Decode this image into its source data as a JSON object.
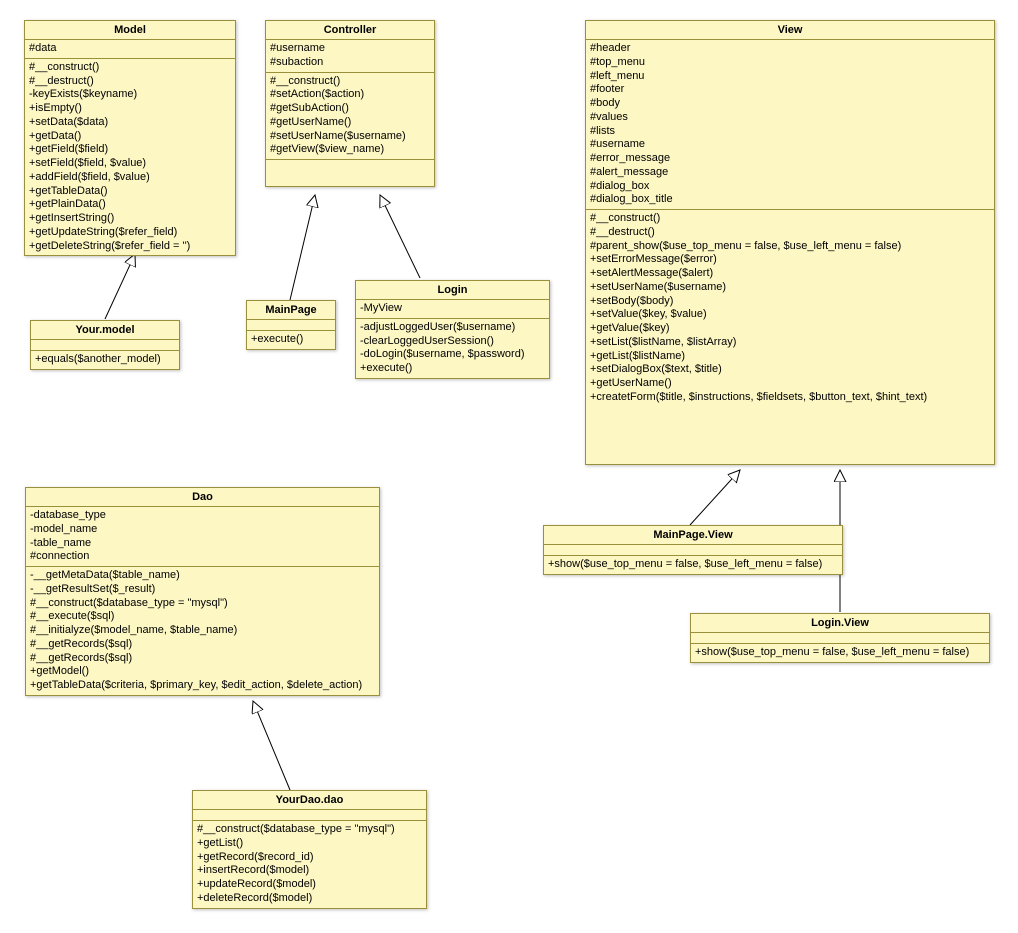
{
  "classes": {
    "model": {
      "name": "Model",
      "attributes": [
        "#data"
      ],
      "methods": [
        "#__construct()",
        "#__destruct()",
        "-keyExists($keyname)",
        "+isEmpty()",
        "+setData($data)",
        "+getData()",
        "+getField($field)",
        "+setField($field, $value)",
        "+addField($field, $value)",
        "+getTableData()",
        "+getPlainData()",
        "+getInsertString()",
        "+getUpdateString($refer_field)",
        "+getDeleteString($refer_field = '')"
      ]
    },
    "controller": {
      "name": "Controller",
      "attributes": [
        "#username",
        "#subaction"
      ],
      "methods": [
        "#__construct()",
        "#setAction($action)",
        "#getSubAction()",
        "#getUserName()",
        "#setUserName($username)",
        "#getView($view_name)"
      ]
    },
    "view": {
      "name": "View",
      "attributes": [
        "#header",
        "#top_menu",
        "#left_menu",
        "#footer",
        "#body",
        "#values",
        "#lists",
        "#username",
        "#error_message",
        "#alert_message",
        "#dialog_box",
        "#dialog_box_title"
      ],
      "methods": [
        "#__construct()",
        "#__destruct()",
        "#parent_show($use_top_menu = false, $use_left_menu = false)",
        "+setErrorMessage($error)",
        "+setAlertMessage($alert)",
        "+setUserName($username)",
        "+setBody($body)",
        "+setValue($key, $value)",
        "+getValue($key)",
        "+setList($listName, $listArray)",
        "+getList($listName)",
        "+setDialogBox($text, $title)",
        "+getUserName()",
        "+createtForm($title, $instructions, $fieldsets, $button_text, $hint_text)"
      ]
    },
    "your_model": {
      "name": "Your.model",
      "attributes": [],
      "methods": [
        "+equals($another_model)"
      ]
    },
    "mainpage": {
      "name": "MainPage",
      "attributes": [],
      "methods": [
        "+execute()"
      ]
    },
    "login": {
      "name": "Login",
      "attributes": [
        "-MyView"
      ],
      "methods": [
        "-adjustLoggedUser($username)",
        "-clearLoggedUserSession()",
        "-doLogin($username, $password)",
        "+execute()"
      ]
    },
    "dao": {
      "name": "Dao",
      "attributes": [
        "-database_type",
        "-model_name",
        "-table_name",
        "#connection"
      ],
      "methods": [
        "-__getMetaData($table_name)",
        "-__getResultSet($_result)",
        "#__construct($database_type = \"mysql\")",
        "#__execute($sql)",
        "#__initialyze($model_name, $table_name)",
        "#__getRecords($sql)",
        "#__getRecords($sql)",
        "+getModel()",
        "+getTableData($criteria, $primary_key, $edit_action, $delete_action)"
      ]
    },
    "yourdao": {
      "name": "YourDao.dao",
      "attributes": [],
      "methods": [
        "#__construct($database_type = \"mysql\")",
        "+getList()",
        "+getRecord($record_id)",
        "+insertRecord($model)",
        "+updateRecord($model)",
        "+deleteRecord($model)"
      ]
    },
    "mainpage_view": {
      "name": "MainPage.View",
      "attributes": [],
      "methods": [
        "+show($use_top_menu = false, $use_left_menu = false)"
      ]
    },
    "login_view": {
      "name": "Login.View",
      "attributes": [],
      "methods": [
        "+show($use_top_menu = false, $use_left_menu = false)"
      ]
    }
  },
  "relationships": [
    {
      "from": "your_model",
      "to": "model",
      "type": "generalization"
    },
    {
      "from": "mainpage",
      "to": "controller",
      "type": "generalization"
    },
    {
      "from": "login",
      "to": "controller",
      "type": "generalization"
    },
    {
      "from": "yourdao",
      "to": "dao",
      "type": "generalization"
    },
    {
      "from": "mainpage_view",
      "to": "view",
      "type": "generalization"
    },
    {
      "from": "login_view",
      "to": "view",
      "type": "generalization"
    }
  ]
}
